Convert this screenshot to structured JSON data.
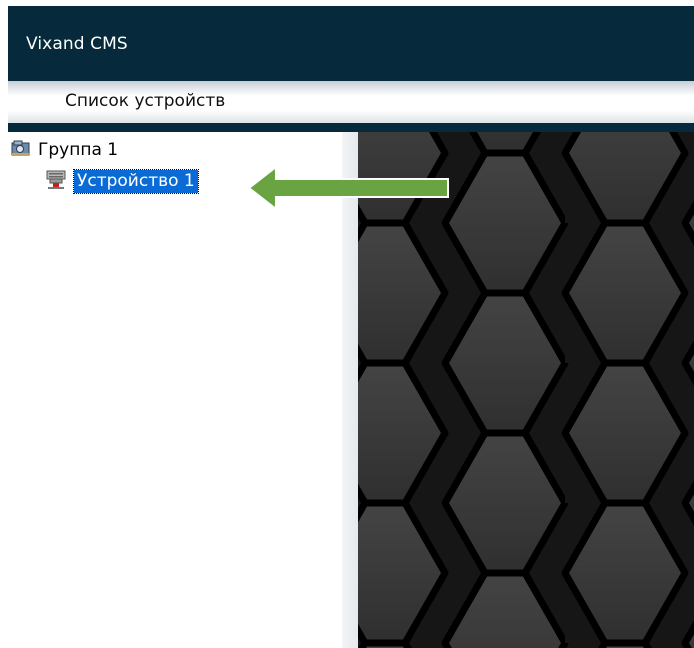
{
  "app": {
    "title": "Vixand CMS"
  },
  "tab": {
    "label": "Список устройств"
  },
  "tree": {
    "group": {
      "label": "Группа 1",
      "icon": "camera-group-icon"
    },
    "device": {
      "label": "Устройство 1",
      "icon": "network-device-icon",
      "selected": true
    }
  },
  "colors": {
    "header": "#062a3b",
    "selection": "#0a6bd6",
    "arrow": "#6aa342",
    "hex_fill": "#3a3a3a",
    "hex_border": "#000000"
  }
}
